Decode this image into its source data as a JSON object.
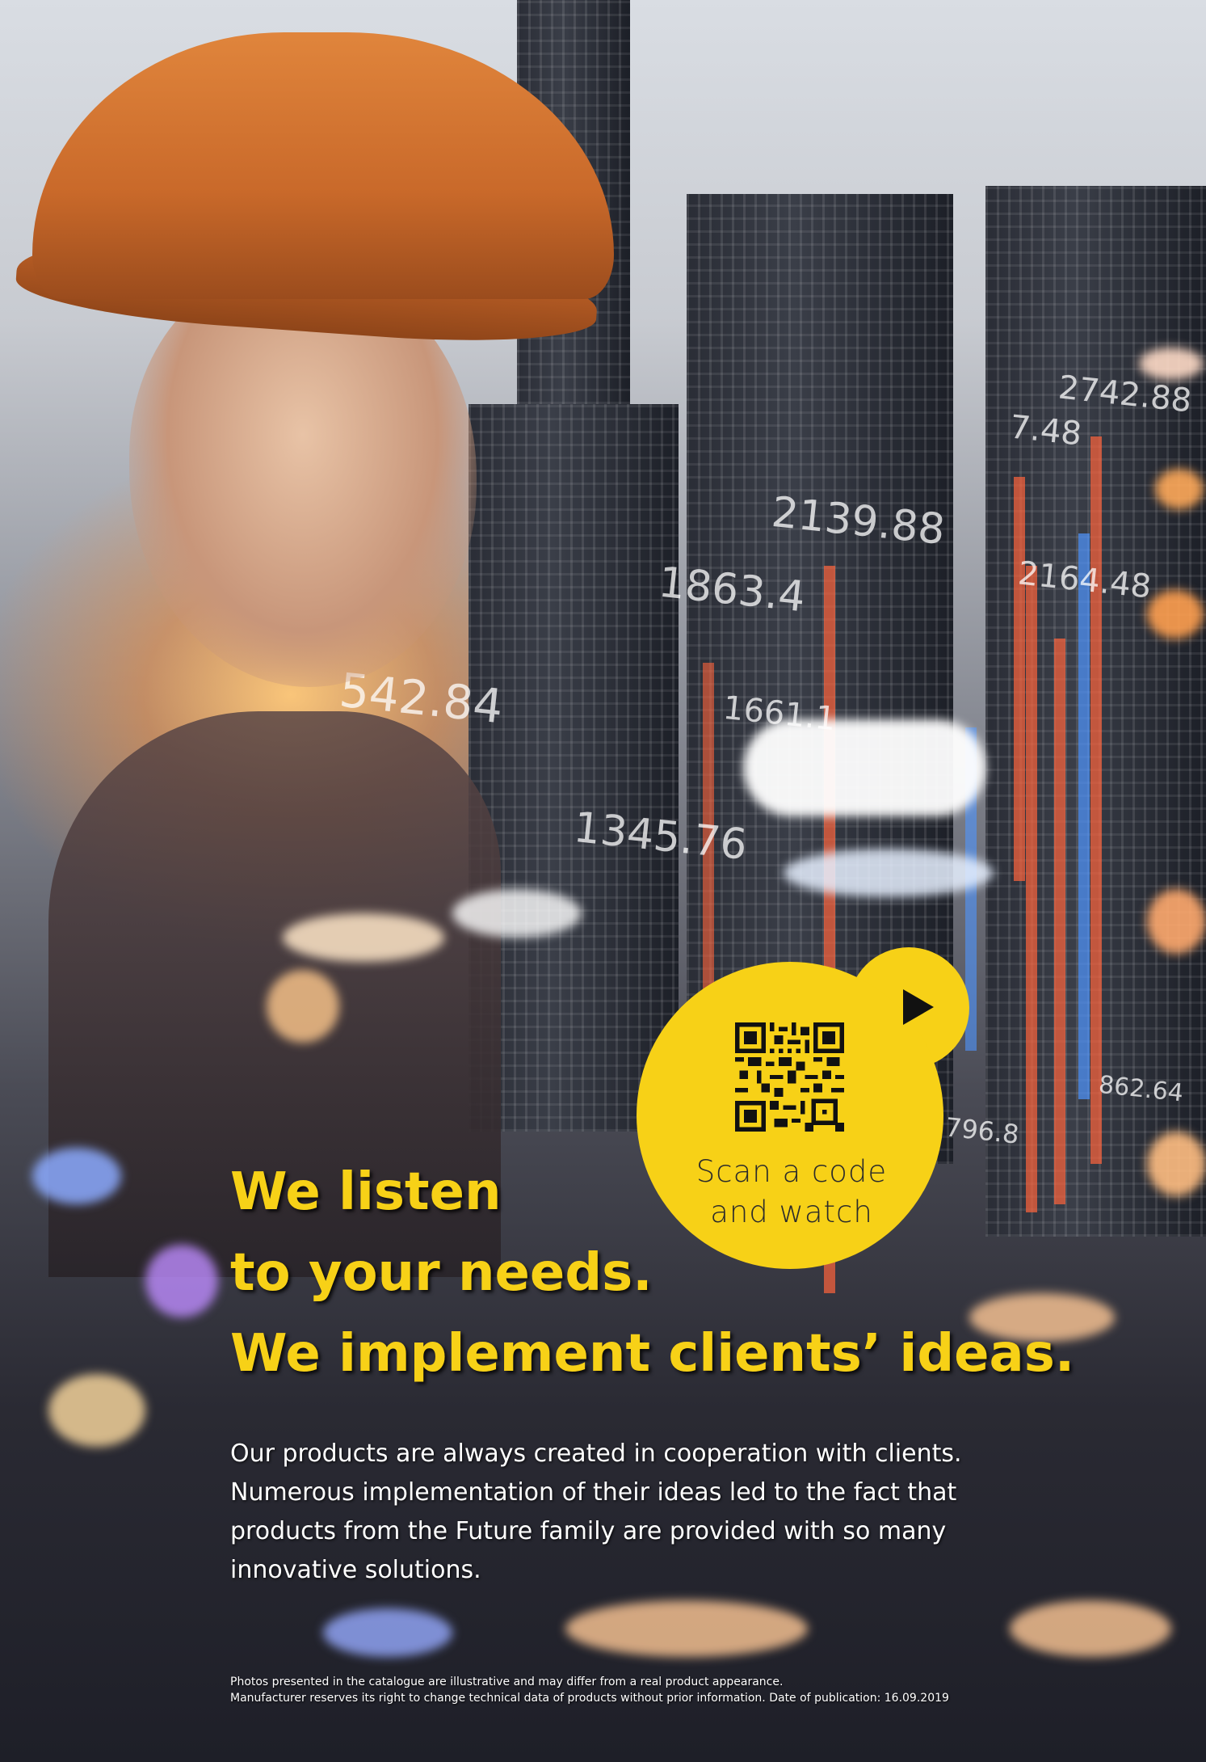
{
  "qr": {
    "caption_line1": "Scan a code",
    "caption_line2": "and watch",
    "play_icon": "play-icon",
    "badge_color": "#f7d117"
  },
  "headline": {
    "line1": "We listen",
    "line2": "to your needs.",
    "line3": "We implement clients’ ideas.",
    "color": "#f7d117"
  },
  "body": {
    "line1": "Our products are always created in cooperation with clients.",
    "line2": "Numerous implementation of their ideas led to the fact that",
    "line3": "products from the Future family are provided with so many",
    "line4": "innovative solutions."
  },
  "footnote": {
    "line1": "Photos presented in the catalogue are illustrative and may differ from a real product appearance.",
    "line2": "Manufacturer reserves its right to change technical data of products without prior information. Date of publication: 16.09.2019"
  },
  "overlay_numbers": [
    "2742.88",
    "7.48",
    "2139.88",
    "1863.4",
    "2164.48",
    "542.84",
    "1661.1",
    "1345.76",
    "862.64",
    "796.8"
  ]
}
